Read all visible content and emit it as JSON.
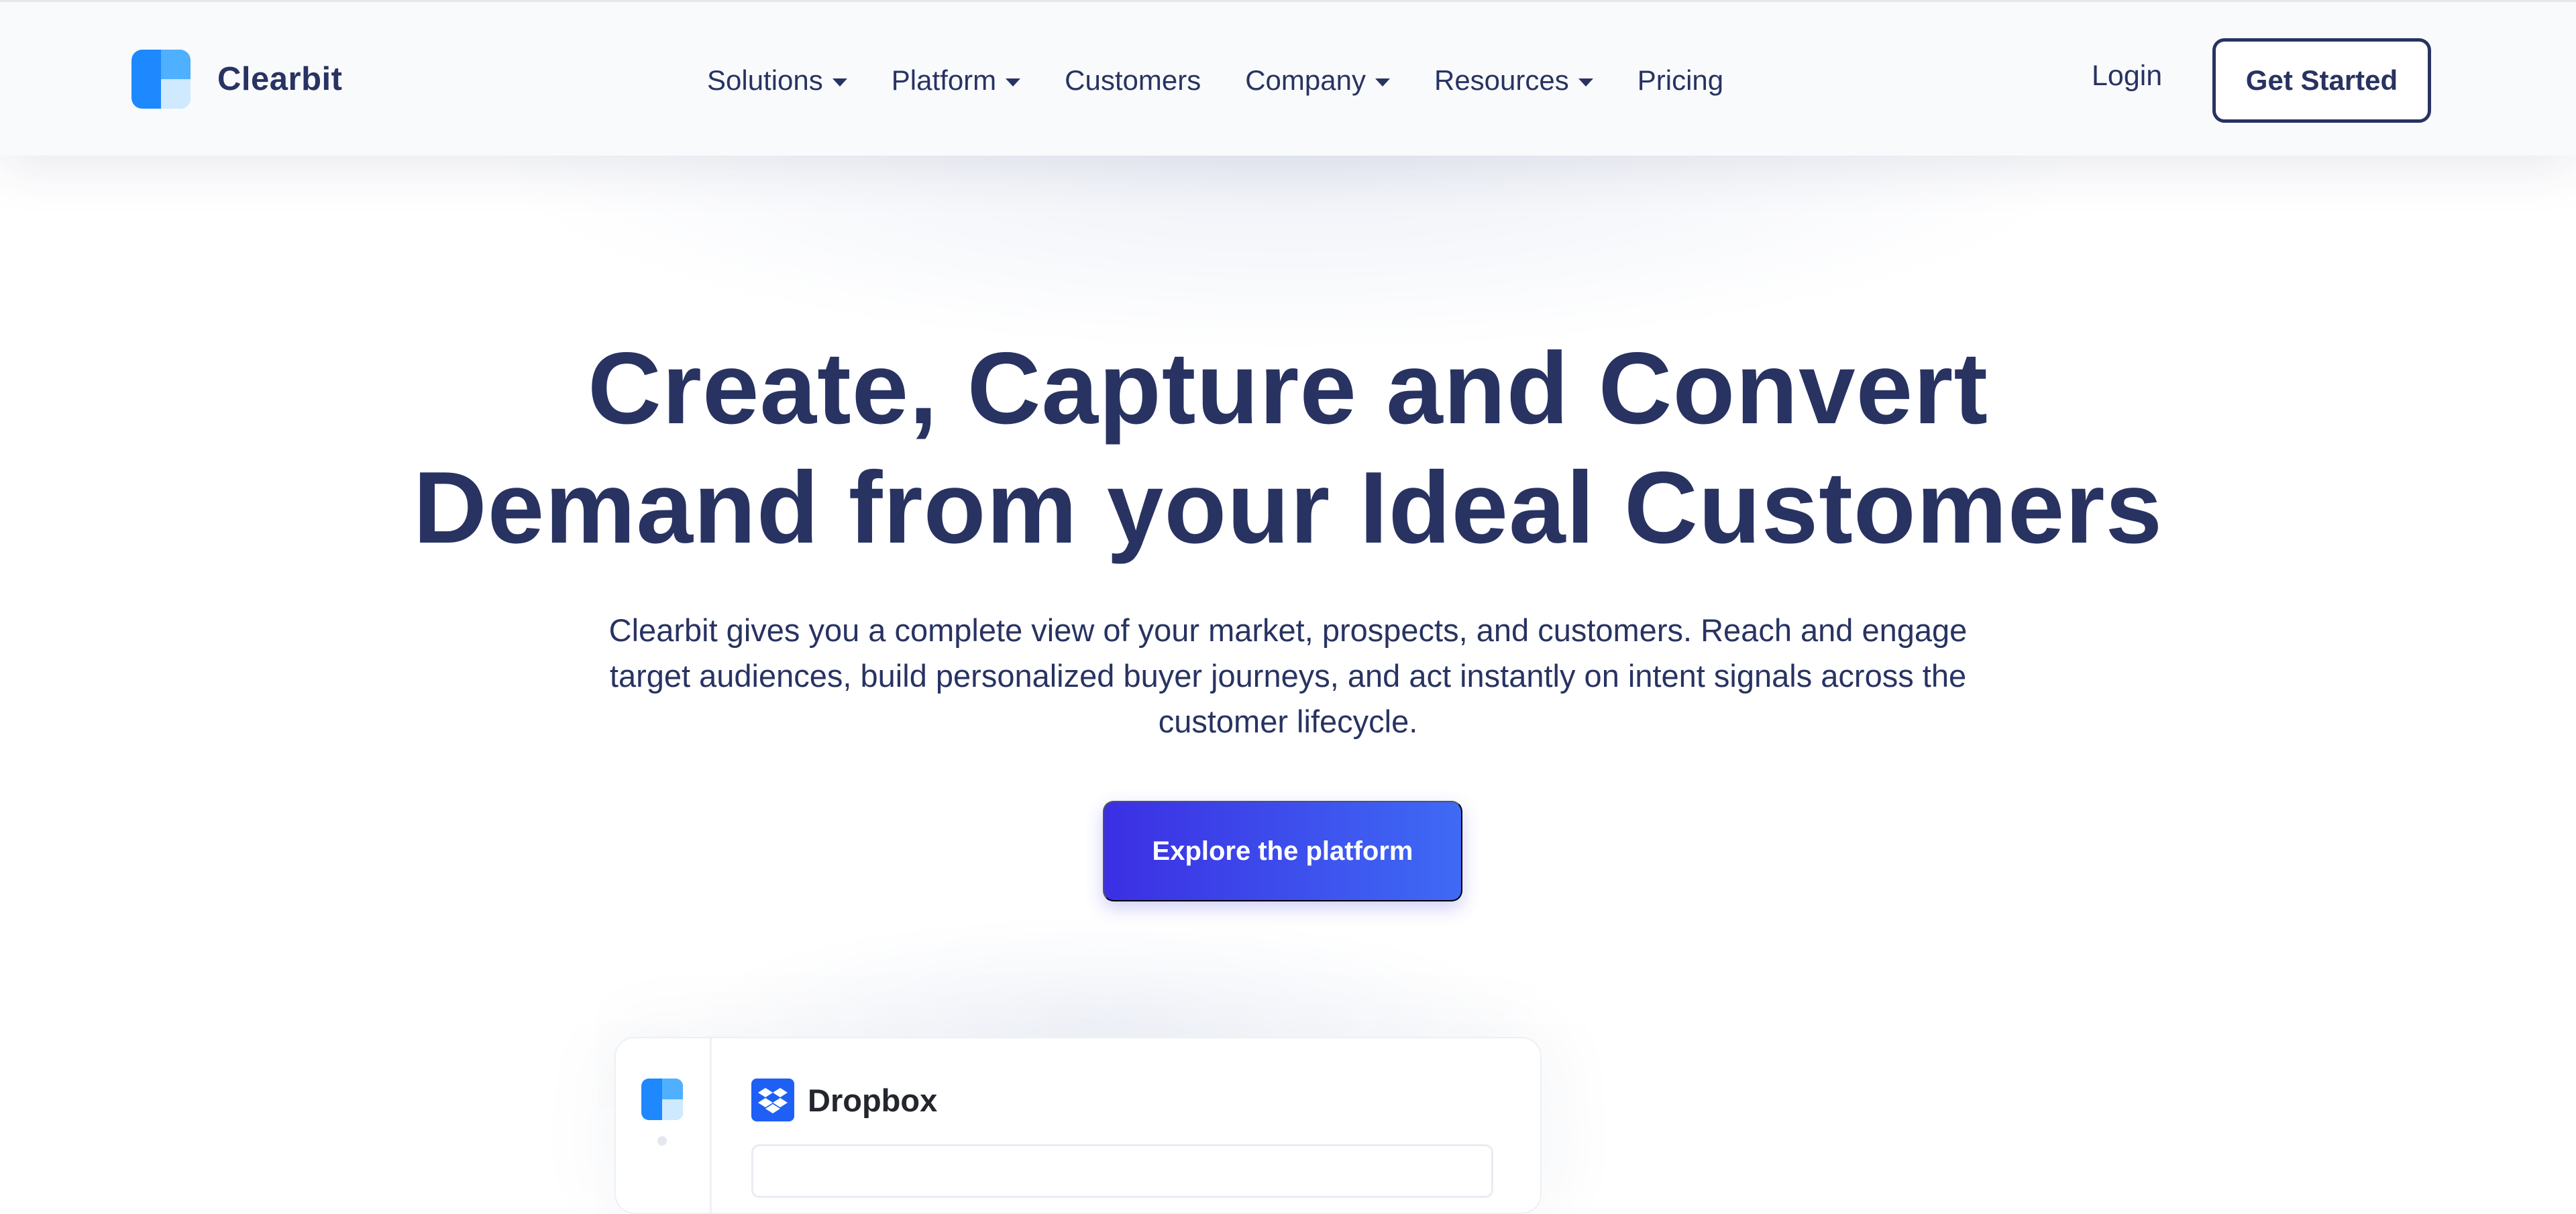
{
  "brand": {
    "name": "Clearbit",
    "logo_icon": "clearbit-logo-icon",
    "logo_colors": [
      "#1e88ff",
      "#4fb0ff",
      "#cfeaff"
    ]
  },
  "nav": {
    "items": [
      {
        "label": "Solutions",
        "dropdown": true
      },
      {
        "label": "Platform",
        "dropdown": true
      },
      {
        "label": "Customers",
        "dropdown": false
      },
      {
        "label": "Company",
        "dropdown": true
      },
      {
        "label": "Resources",
        "dropdown": true
      },
      {
        "label": "Pricing",
        "dropdown": false
      }
    ],
    "login_label": "Login",
    "get_started_label": "Get Started"
  },
  "hero": {
    "title_line1": "Create, Capture and Convert",
    "title_line2": "Demand from your Ideal Customers",
    "subtitle": "Clearbit gives you a complete view of your market, prospects, and customers. Reach and engage target audiences, build personalized buyer journeys, and act instantly on intent signals across the customer lifecycle.",
    "cta_label": "Explore the platform"
  },
  "preview": {
    "company_name": "Dropbox",
    "company_icon": "dropbox-icon"
  },
  "colors": {
    "text": "#283362",
    "cta_gradient_start": "#3b2fe3",
    "cta_gradient_end": "#3f6af5",
    "dropbox_blue": "#1e60f5"
  }
}
